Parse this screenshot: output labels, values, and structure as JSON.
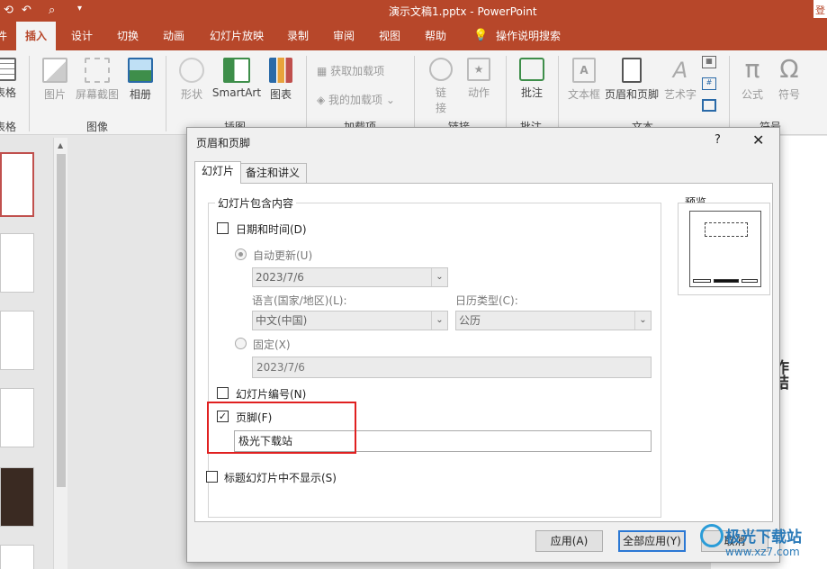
{
  "titlebar": {
    "title": "演示文稿1.pptx  -  PowerPoint",
    "login": "登"
  },
  "tabs": [
    {
      "label": "件"
    },
    {
      "label": "插入"
    },
    {
      "label": "设计"
    },
    {
      "label": "切换"
    },
    {
      "label": "动画"
    },
    {
      "label": "幻灯片放映"
    },
    {
      "label": "录制"
    },
    {
      "label": "审阅"
    },
    {
      "label": "视图"
    },
    {
      "label": "帮助"
    },
    {
      "label": "操作说明搜索"
    }
  ],
  "ribbon": {
    "table": "表格",
    "table_group": "表格",
    "picture": "图片",
    "screenshot": "屏幕截图",
    "album": "相册",
    "image_group": "图像",
    "shapes": "形状",
    "smartart": "SmartArt",
    "chart": "图表",
    "illustrations_group": "插图",
    "get_addins": "获取加载项",
    "my_addins": "我的加载项",
    "addins_group": "加载项",
    "link": "链接",
    "action": "动作",
    "links_group": "链接",
    "comment": "批注",
    "comment_group": "批注",
    "textbox": "文本框",
    "header_footer": "页眉和页脚",
    "wordart": "艺术字",
    "text_group": "文本",
    "equation": "公式",
    "symbol": "符号",
    "symbols_group": "符号"
  },
  "slide_text": "作\n结",
  "dialog": {
    "title": "页眉和页脚",
    "help": "?",
    "close": "✕",
    "tab_slide": "幻灯片",
    "tab_notes": "备注和讲义",
    "group_label": "幻灯片包含内容",
    "date_time": "日期和时间(D)",
    "auto_update": "自动更新(U)",
    "date_value": "2023/7/6",
    "language_label": "语言(国家/地区)(L):",
    "language_value": "中文(中国)",
    "calendar_label": "日历类型(C):",
    "calendar_value": "公历",
    "fixed": "固定(X)",
    "fixed_value": "2023/7/6",
    "slide_number": "幻灯片编号(N)",
    "footer": "页脚(F)",
    "footer_value": "极光下载站",
    "hide_on_title": "标题幻灯片中不显示(S)",
    "preview": "预览",
    "apply": "应用(A)",
    "apply_all": "全部应用(Y)",
    "cancel": "取消"
  },
  "state": {
    "date_time_checked": false,
    "slide_number_checked": false,
    "footer_checked": true,
    "hide_on_title_checked": false,
    "checked_mark": "✓"
  },
  "watermark": {
    "name": "极光下载站",
    "url": "www.xz7.com"
  },
  "colors": {
    "accent": "#b7472a",
    "highlight": "#e02020",
    "default_button": "#2b78d4"
  }
}
